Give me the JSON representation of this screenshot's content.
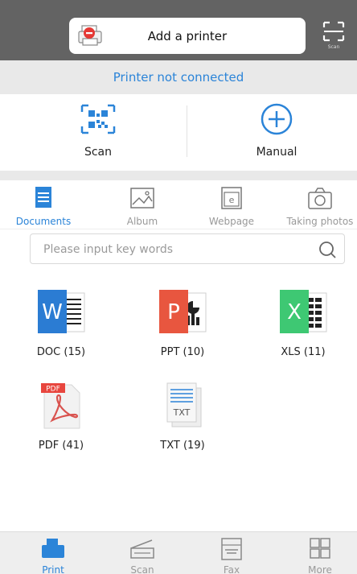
{
  "header": {
    "add_printer_label": "Add a printer",
    "scan_small_label": "Scan"
  },
  "status": {
    "text": "Printer not connected",
    "color": "#2b84d8"
  },
  "actions": {
    "scan_label": "Scan",
    "manual_label": "Manual"
  },
  "tabs": [
    {
      "label": "Documents",
      "icon": "document-icon",
      "active": true
    },
    {
      "label": "Album",
      "icon": "image-icon",
      "active": false
    },
    {
      "label": "Webpage",
      "icon": "webpage-icon",
      "active": false
    },
    {
      "label": "Taking photos",
      "icon": "camera-icon",
      "active": false
    }
  ],
  "search": {
    "placeholder": "Please input key words",
    "value": ""
  },
  "files": [
    {
      "label": "DOC (15)",
      "icon": "word-file-icon"
    },
    {
      "label": "PPT (10)",
      "icon": "powerpoint-file-icon"
    },
    {
      "label": "XLS (11)",
      "icon": "excel-file-icon"
    },
    {
      "label": "PDF (41)",
      "icon": "pdf-file-icon"
    },
    {
      "label": "TXT (19)",
      "icon": "txt-file-icon"
    }
  ],
  "pdf_badge": "PDF",
  "txt_badge": "TXT",
  "bottom_nav": [
    {
      "label": "Print",
      "icon": "print-icon",
      "active": true
    },
    {
      "label": "Scan",
      "icon": "scanner-icon",
      "active": false
    },
    {
      "label": "Fax",
      "icon": "fax-icon",
      "active": false
    },
    {
      "label": "More",
      "icon": "grid-icon",
      "active": false
    }
  ],
  "colors": {
    "accent": "#2b84d8",
    "header_bg": "#636363",
    "word": "#2b7cd3",
    "powerpoint": "#e8563f",
    "excel": "#3ec873",
    "pdf": "#d9534f"
  }
}
